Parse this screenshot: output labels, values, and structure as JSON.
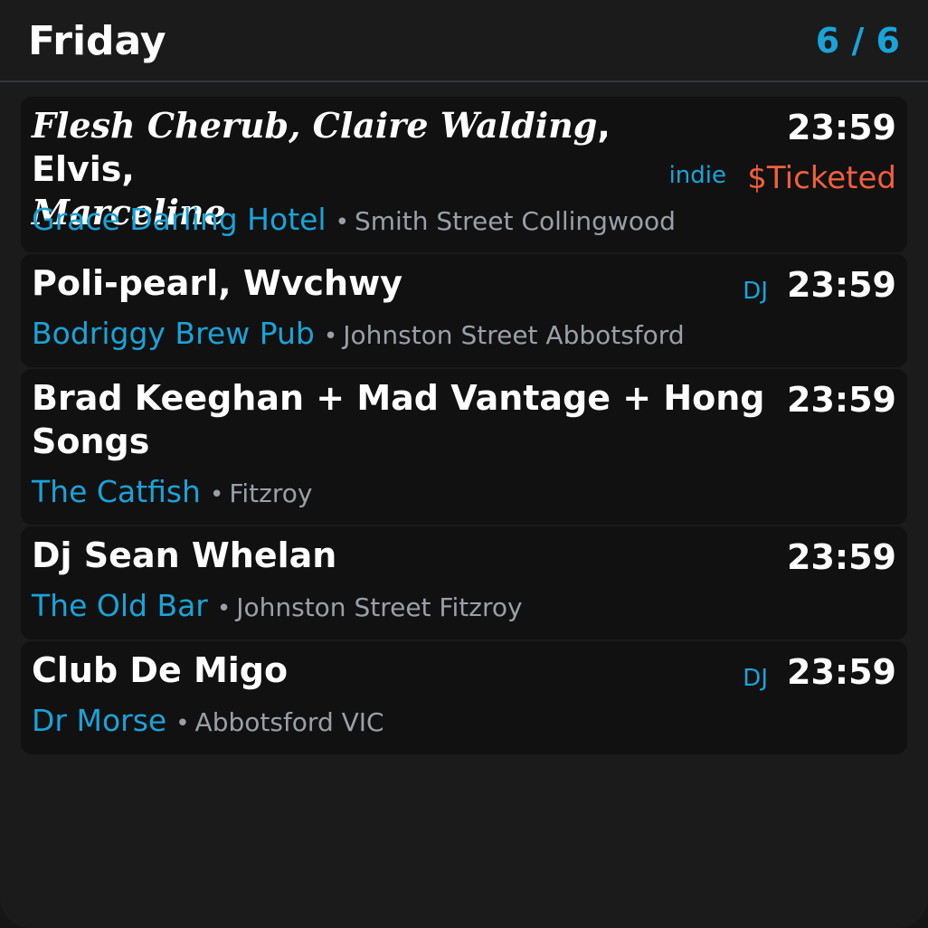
{
  "header": {
    "title": "Friday",
    "page": "6 / 6"
  },
  "events": [
    {
      "artists_serif": "Flesh Cherub, Claire Walding",
      "artists_plain": ", Elvis,",
      "artists_serif2": "Marceline",
      "time": "23:59",
      "genre": "indie",
      "price": "$Ticketed",
      "venue": "Grace Darling Hotel",
      "separator": "•",
      "location": "Smith Street Collingwood"
    },
    {
      "artists": "Poli-pearl, Wvchwy",
      "time": "23:59",
      "genre": "DJ",
      "venue": "Bodriggy Brew Pub",
      "separator": "•",
      "location": "Johnston Street Abbotsford"
    },
    {
      "artists": "Brad Keeghan + Mad Vantage + Hong Songs",
      "time": "23:59",
      "venue": "The Catfish",
      "separator": "•",
      "location": "Fitzroy"
    },
    {
      "artists": "Dj Sean Whelan",
      "time": "23:59",
      "venue": "The Old Bar",
      "separator": "•",
      "location": "Johnston Street Fitzroy"
    },
    {
      "artists": "Club De Migo",
      "time": "23:59",
      "genre": "DJ",
      "venue": "Dr Morse",
      "separator": "•",
      "location": "Abbotsford VIC"
    }
  ]
}
